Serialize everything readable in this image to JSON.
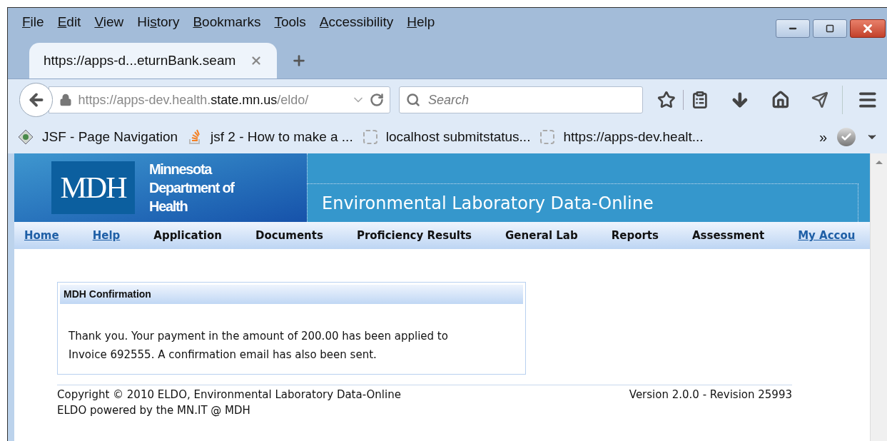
{
  "menu_bar": [
    {
      "access_key": "F",
      "after": "ile"
    },
    {
      "access_key": "E",
      "after": "dit"
    },
    {
      "access_key": "V",
      "after": "iew"
    },
    {
      "before": "Hi",
      "access_key": "s",
      "after": "tory"
    },
    {
      "access_key": "B",
      "after": "ookmarks"
    },
    {
      "access_key": "T",
      "after": "ools"
    },
    {
      "access_key": "A",
      "after": "ccessibility"
    },
    {
      "access_key": "H",
      "after": "elp"
    }
  ],
  "tabs": [
    {
      "label": "https://apps-d...eturnBank.seam",
      "selected": true
    }
  ],
  "address_bar": {
    "url_start": "https://apps-dev.health.",
    "url_domain": "state.mn.us",
    "url_end": "/eldo/"
  },
  "search": {
    "placeholder": "Search"
  },
  "bookmarks": [
    {
      "label": "JSF - Page Navigation",
      "kind": "gear"
    },
    {
      "label": "jsf 2 - How to make a ...",
      "kind": "stack"
    },
    {
      "label": "localhost submitstatus...",
      "kind": "blank"
    },
    {
      "label": "https://apps-dev.healt...",
      "kind": "blank"
    }
  ],
  "bookmarks_overflow": "»",
  "site": {
    "logo": "MDH",
    "org_name": "Minnesota Department of Health",
    "title": "Environmental Laboratory Data-Online"
  },
  "nav": [
    {
      "label": "Home",
      "link": true
    },
    {
      "label": "Help",
      "link": true
    },
    {
      "label": "Application",
      "link": false
    },
    {
      "label": "Documents",
      "link": false
    },
    {
      "label": "Proficiency Results",
      "link": false
    },
    {
      "label": "General Lab",
      "link": false
    },
    {
      "label": "Reports",
      "link": false
    },
    {
      "label": "Assessment",
      "link": false
    },
    {
      "label": "My Accou",
      "link": true
    }
  ],
  "panel": {
    "title": "MDH Confirmation",
    "message": "Thank you. Your payment in the amount of 200.00 has been applied to Invoice 692555. A confirmation email has also been sent."
  },
  "footer": {
    "copyright": "Copyright © 2010 ELDO, Environmental Laboratory Data-Online",
    "powered_by": "ELDO powered by the MN.IT @ MDH",
    "version": "Version 2.0.0 - Revision 25993"
  }
}
